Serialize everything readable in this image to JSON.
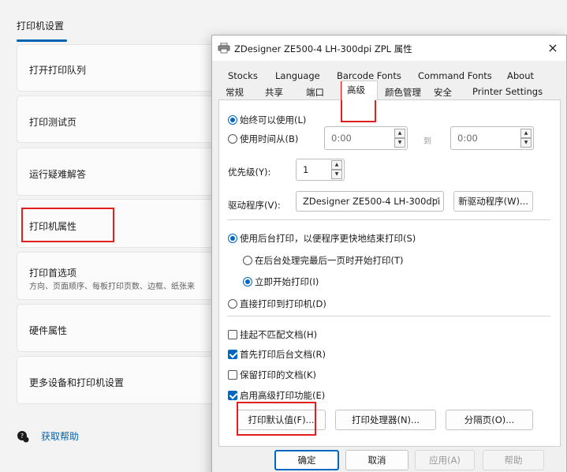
{
  "settings": {
    "title": "打印机设置",
    "items": [
      {
        "label": "打开打印队列"
      },
      {
        "label": "打印测试页"
      },
      {
        "label": "运行疑难解答"
      },
      {
        "label": "打印机属性"
      },
      {
        "label": "打印首选项",
        "sublabel": "方向、页面顺序、每板打印页数、边框、纸张来"
      },
      {
        "label": "硬件属性"
      },
      {
        "label": "更多设备和打印机设置"
      }
    ],
    "help": "获取帮助"
  },
  "dialog": {
    "title": "ZDesigner ZE500-4 LH-300dpi ZPL 属性",
    "close": "×",
    "tabs_row1": [
      "Stocks",
      "Language",
      "Barcode Fonts",
      "Command Fonts",
      "About"
    ],
    "tabs_row2": [
      "常规",
      "共享",
      "端口",
      "高级",
      "颜色管理",
      "安全",
      "Printer Settings"
    ],
    "active_tab": "高级",
    "availability": {
      "always": "始终可以使用(L)",
      "from": "使用时间从(B)",
      "from_value": "0:00",
      "to_label": "到",
      "to_value": "0:00"
    },
    "priority": {
      "label": "优先级(Y):",
      "value": "1"
    },
    "driver": {
      "label": "驱动程序(V):",
      "value": "ZDesigner ZE500-4 LH-300dpi",
      "new_button": "新驱动程序(W)..."
    },
    "spool": {
      "use_spool": "使用后台打印，以便程序更快地结束打印(S)",
      "after_last_page": "在后台处理完最后一页时开始打印(T)",
      "immediately": "立即开始打印(I)",
      "direct": "直接打印到打印机(D)"
    },
    "options": {
      "hold_mismatched": "挂起不匹配文档(H)",
      "spooled_first": "首先打印后台文档(R)",
      "keep_printed": "保留打印的文档(K)",
      "advanced_features": "启用高级打印功能(E)"
    },
    "buttons": {
      "defaults": "打印默认值(F)...",
      "processor": "打印处理器(N)...",
      "separator": "分隔页(O)...",
      "ok": "确定",
      "cancel": "取消",
      "apply": "应用(A)",
      "help": "帮助"
    }
  },
  "colors": {
    "accent": "#0067c0",
    "highlight": "#e0201f",
    "link": "#0063b1"
  }
}
